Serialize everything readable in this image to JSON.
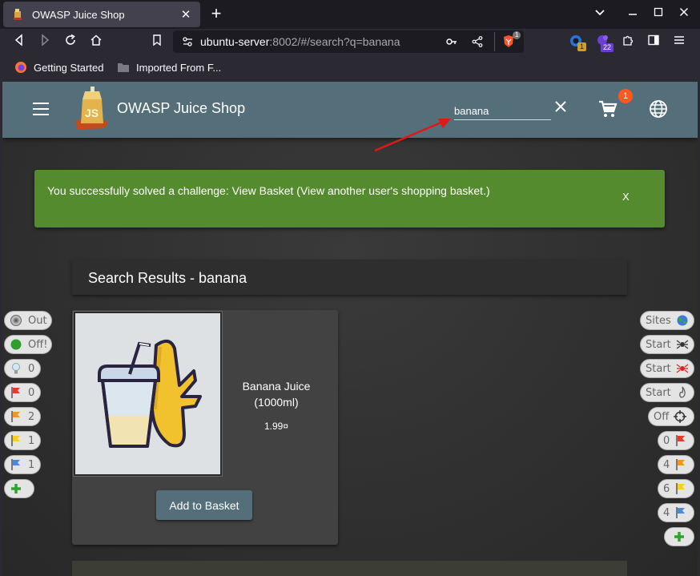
{
  "browser": {
    "tab_title": "OWASP Juice Shop",
    "tab_close": "✕",
    "new_tab": "+",
    "url_host": "ubuntu-server",
    "url_rest": ":8002/#/search?q=banana",
    "bookmarks": [
      "Getting Started",
      "Imported From F..."
    ],
    "brave_badge": "1",
    "ext_badge_1": "1",
    "ext_badge_2": "22"
  },
  "app": {
    "title": "OWASP Juice Shop",
    "search_value": "banana",
    "cart_count": "1"
  },
  "notification": {
    "message": "You successfully solved a challenge: View Basket (View another user's shopping basket.)",
    "close": "X"
  },
  "results": {
    "title": "Search Results - banana"
  },
  "product": {
    "name": "Banana Juice (1000ml)",
    "price": "1.99¤",
    "add_label": "Add to Basket"
  },
  "left_panel": [
    {
      "label": "Out",
      "icon": "target-icon"
    },
    {
      "label": "Off!",
      "icon": "green-dot-icon"
    },
    {
      "label": "0",
      "icon": "lightbulb-icon"
    },
    {
      "label": "0",
      "icon": "red-flag-icon"
    },
    {
      "label": "2",
      "icon": "orange-flag-icon"
    },
    {
      "label": "1",
      "icon": "yellow-flag-icon"
    },
    {
      "label": "1",
      "icon": "blue-flag-icon"
    },
    {
      "label": "",
      "icon": "plus-icon"
    }
  ],
  "right_panel": [
    {
      "label": "Sites",
      "icon": "globe-icon"
    },
    {
      "label": "Start",
      "icon": "spider-icon"
    },
    {
      "label": "Start",
      "icon": "red-spider-icon"
    },
    {
      "label": "Start",
      "icon": "flame-icon"
    },
    {
      "label": "Off",
      "icon": "crosshair-icon"
    },
    {
      "label": "0",
      "icon": "red-flag-icon"
    },
    {
      "label": "4",
      "icon": "orange-flag-icon"
    },
    {
      "label": "6",
      "icon": "yellow-flag-icon"
    },
    {
      "label": "4",
      "icon": "blue-flag-icon"
    },
    {
      "label": "",
      "icon": "plus-icon"
    }
  ],
  "colors": {
    "toolbar": "#546e7a",
    "success": "#558b2f",
    "badge": "#ff5722"
  }
}
